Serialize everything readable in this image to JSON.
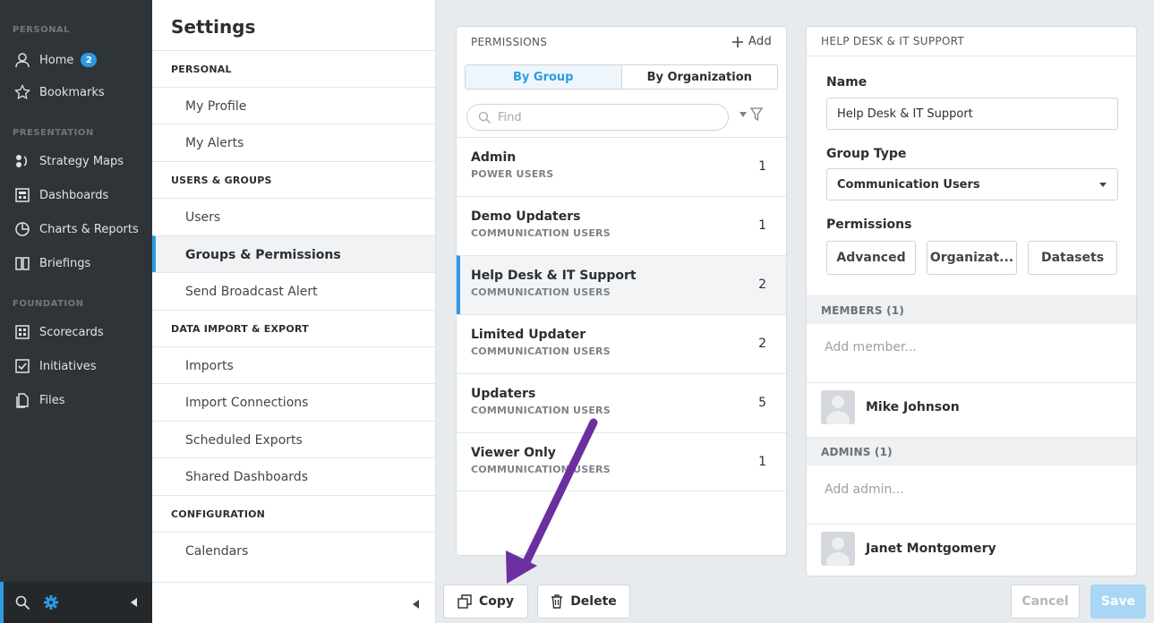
{
  "nav": {
    "sections": {
      "personal": "PERSONAL",
      "presentation": "PRESENTATION",
      "foundation": "FOUNDATION"
    },
    "items": [
      {
        "label": "Home",
        "icon": "user-icon",
        "badge": "2"
      },
      {
        "label": "Bookmarks",
        "icon": "star-icon"
      },
      {
        "label": "Strategy Maps",
        "icon": "strategy-map-icon"
      },
      {
        "label": "Dashboards",
        "icon": "dashboard-icon"
      },
      {
        "label": "Charts & Reports",
        "icon": "pie-chart-icon"
      },
      {
        "label": "Briefings",
        "icon": "book-icon"
      },
      {
        "label": "Scorecards",
        "icon": "scorecard-icon"
      },
      {
        "label": "Initiatives",
        "icon": "checkbox-icon"
      },
      {
        "label": "Files",
        "icon": "files-icon"
      }
    ],
    "accent": "#2d9be3"
  },
  "settings": {
    "title": "Settings",
    "headings": [
      "PERSONAL",
      "USERS & GROUPS",
      "DATA IMPORT & EXPORT",
      "CONFIGURATION"
    ],
    "items": [
      "My Profile",
      "My Alerts",
      "Users",
      "Groups & Permissions",
      "Send Broadcast Alert",
      "Imports",
      "Import Connections",
      "Scheduled Exports",
      "Shared Dashboards",
      "Calendars"
    ]
  },
  "permissions": {
    "title": "PERMISSIONS",
    "add_label": "Add",
    "tabs": [
      "By Group",
      "By Organization"
    ],
    "find_placeholder": "Find",
    "groups": [
      {
        "name": "Admin",
        "type": "POWER USERS",
        "count": "1"
      },
      {
        "name": "Demo Updaters",
        "type": "COMMUNICATION USERS",
        "count": "1"
      },
      {
        "name": "Help Desk & IT Support",
        "type": "COMMUNICATION USERS",
        "count": "2"
      },
      {
        "name": "Limited Updater",
        "type": "COMMUNICATION USERS",
        "count": "2"
      },
      {
        "name": "Updaters",
        "type": "COMMUNICATION USERS",
        "count": "5"
      },
      {
        "name": "Viewer Only",
        "type": "COMMUNICATION USERS",
        "count": "1"
      }
    ]
  },
  "detail": {
    "title": "HELP DESK & IT SUPPORT",
    "name_label": "Name",
    "name_value": "Help Desk & IT Support",
    "type_label": "Group Type",
    "type_value": "Communication Users",
    "perm_label": "Permissions",
    "perm_buttons": [
      "Advanced",
      "Organizat...",
      "Datasets"
    ],
    "members_header": "MEMBERS (1)",
    "add_member": "Add member...",
    "member": "Mike Johnson",
    "admins_header": "ADMINS (1)",
    "add_admin": "Add admin...",
    "admin": "Janet Montgomery"
  },
  "actions": {
    "copy": "Copy",
    "delete": "Delete",
    "cancel": "Cancel",
    "save": "Save"
  },
  "annotation_color": "#6b2fa0"
}
